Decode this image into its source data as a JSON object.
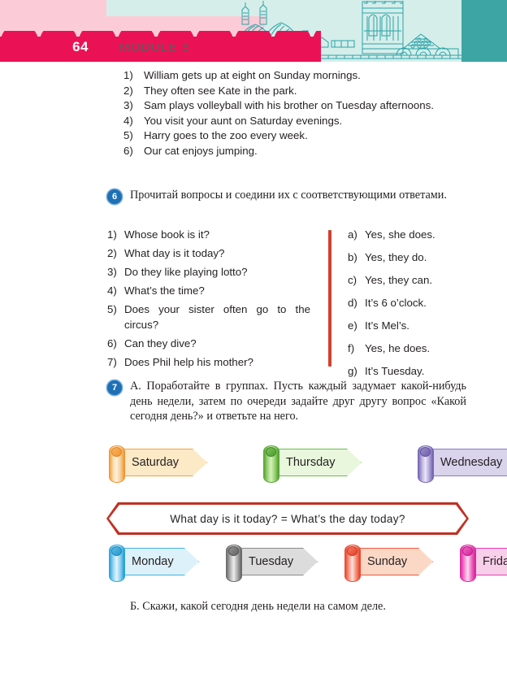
{
  "header": {
    "page_number": "64",
    "module_label": "MODULE  3",
    "colors": {
      "crimson": "#ea1255",
      "pale_pink": "#fbccd7",
      "mint": "#d5eeea",
      "teal": "#3ea5a5"
    },
    "skyline_icon": "city-skyline-line-art"
  },
  "top_list": {
    "items": [
      {
        "num": "1)",
        "text": "William gets up at eight on Sunday mornings."
      },
      {
        "num": "2)",
        "text": "They often see Kate in the park."
      },
      {
        "num": "3)",
        "text": "Sam plays volleyball with his brother on Tuesday afternoons."
      },
      {
        "num": "4)",
        "text": "You visit your aunt on Saturday evenings."
      },
      {
        "num": "5)",
        "text": "Harry goes to the zoo every week."
      },
      {
        "num": "6)",
        "text": "Our cat enjoys jumping."
      }
    ]
  },
  "exercise6": {
    "badge": "6",
    "instruction": "Прочитай вопросы и соедини их с соответствующими ответами.",
    "questions": [
      {
        "num": "1)",
        "text": "Whose book is it?"
      },
      {
        "num": "2)",
        "text": "What day is it today?"
      },
      {
        "num": "3)",
        "text": "Do they like playing lotto?"
      },
      {
        "num": "4)",
        "text": "What’s the time?"
      },
      {
        "num": "5)",
        "text": "Does your sister often go to the circus?"
      },
      {
        "num": "6)",
        "text": "Can they dive?"
      },
      {
        "num": "7)",
        "text": "Does Phil help his mother?"
      }
    ],
    "answers": [
      {
        "num": "a)",
        "text": "Yes, she does."
      },
      {
        "num": "b)",
        "text": "Yes, they do."
      },
      {
        "num": "c)",
        "text": "Yes, they can."
      },
      {
        "num": "d)",
        "text": "It’s 6 o’clock."
      },
      {
        "num": "e)",
        "text": "It’s Mel’s."
      },
      {
        "num": "f)",
        "text": "Yes, he does."
      },
      {
        "num": "g)",
        "text": "It’s Tuesday."
      }
    ],
    "divider_color": "#d1412f"
  },
  "exercise7": {
    "badge": "7",
    "part_a": "А. Поработайте в группах. Пусть каждый задумает какой-нибудь день недели, затем по очереди задайте друг другу вопрос «Какой сегодня день?» и ответьте на него.",
    "part_b": "Б. Скажи, какой сегодня день недели на самом деле.",
    "banners_top": [
      {
        "label": "Saturday",
        "fill": "#fce9c6",
        "border": "#f2a13a",
        "barrel_light": "#fde3bb",
        "barrel_dark": "#ef9433"
      },
      {
        "label": "Thursday",
        "fill": "#e9f7dc",
        "border": "#6cbe45",
        "barrel_light": "#d8efc0",
        "barrel_dark": "#59a838"
      },
      {
        "label": "Wednesday",
        "fill": "#d9d3ec",
        "border": "#8b7cc4",
        "barrel_light": "#ddd7f0",
        "barrel_dark": "#7a6ab5"
      }
    ],
    "equation_box": "What day is it today? = What’s the day today?",
    "equation_box_border": "#bf3123",
    "banners_bottom": [
      {
        "label": "Monday",
        "fill": "#ddf1fa",
        "border": "#3fb3e3",
        "barrel_light": "#d5eefb",
        "barrel_dark": "#2fa6dc"
      },
      {
        "label": "Tuesday",
        "fill": "#dcdcdc",
        "border": "#8a8a8a",
        "barrel_light": "#d8d8d8",
        "barrel_dark": "#6e6e6e"
      },
      {
        "label": "Sunday",
        "fill": "#fbd8c6",
        "border": "#f0563f",
        "barrel_light": "#fbcdbd",
        "barrel_dark": "#ec4a34"
      },
      {
        "label": "Friday",
        "fill": "#f8cfe8",
        "border": "#e83ab0",
        "barrel_light": "#f7c3e2",
        "barrel_dark": "#e02ba3"
      }
    ]
  }
}
